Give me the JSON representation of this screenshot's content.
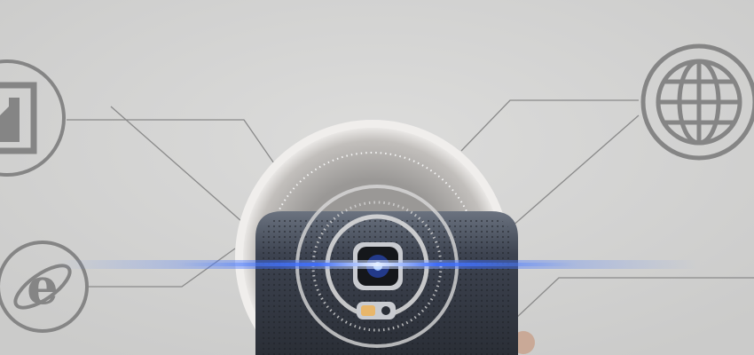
{
  "scene": {
    "subject": "smartphone-rear-camera",
    "icons": [
      "contact-card-icon",
      "internet-explorer-icon",
      "globe-icon"
    ],
    "colors": {
      "background": "#d4d4d3",
      "icon_stroke": "#858585",
      "phone_body": "#3e4450",
      "light_beam": "#3a6bff"
    }
  }
}
